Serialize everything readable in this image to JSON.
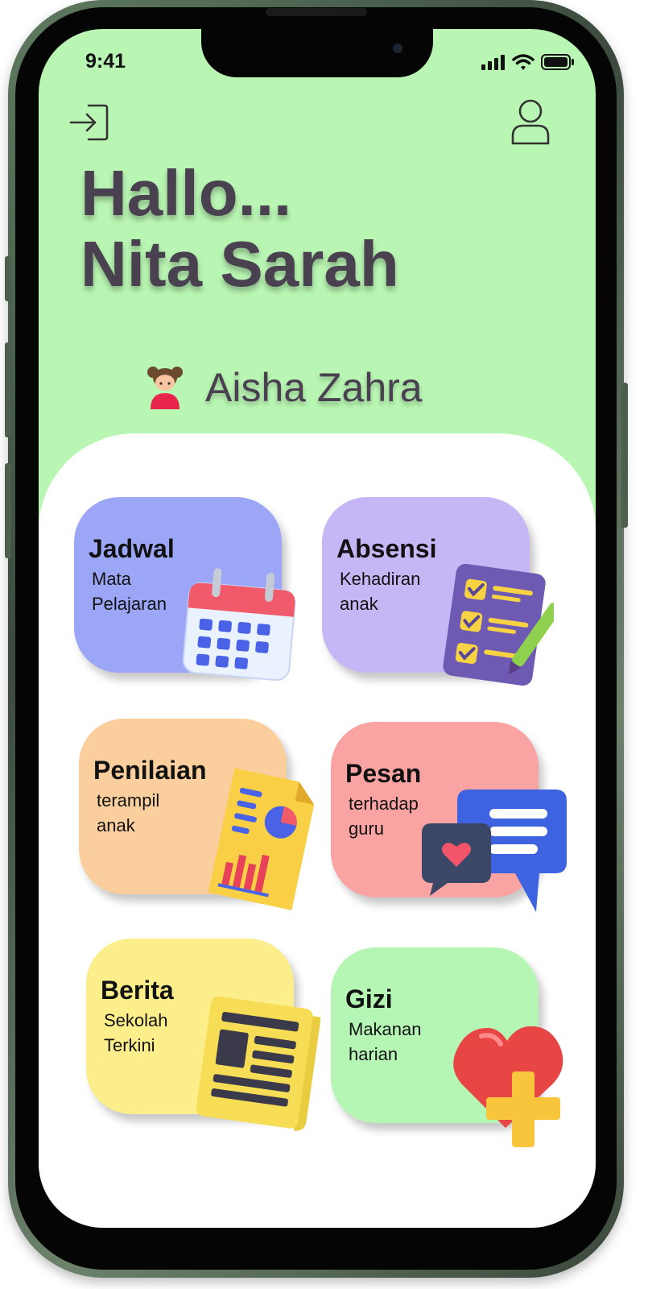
{
  "status_bar": {
    "time": "9:41"
  },
  "header": {
    "login_icon": "login-icon",
    "profile_icon": "user-icon",
    "greeting_line1": "Hallo...",
    "greeting_line2": "Nita Sarah"
  },
  "child": {
    "avatar_icon": "girl-avatar-icon",
    "name": "Aisha Zahra"
  },
  "menu": [
    {
      "title": "Jadwal",
      "subtitle_line1": "Mata",
      "subtitle_line2": "Pelajaran",
      "icon": "calendar-icon",
      "color": "#9ca6f7"
    },
    {
      "title": "Absensi",
      "subtitle_line1": "Kehadiran",
      "subtitle_line2": "anak",
      "icon": "checklist-icon",
      "color": "#c7b6f5"
    },
    {
      "title": "Penilaian",
      "subtitle_line1": "terampil",
      "subtitle_line2": "anak",
      "icon": "report-chart-icon",
      "color": "#fbcf9d"
    },
    {
      "title": "Pesan",
      "subtitle_line1": "terhadap",
      "subtitle_line2": "guru",
      "icon": "chat-bubbles-icon",
      "color": "#f9a3a2"
    },
    {
      "title": "Berita",
      "subtitle_line1": "Sekolah",
      "subtitle_line2": "Terkini",
      "icon": "newspaper-icon",
      "color": "#fcee8b"
    },
    {
      "title": "Gizi",
      "subtitle_line1": "Makanan",
      "subtitle_line2": "harian",
      "icon": "heart-plus-icon",
      "color": "#b6f6b4"
    }
  ],
  "colors": {
    "header_bg": "#b9f6b3",
    "text_dark": "#4a4150"
  }
}
